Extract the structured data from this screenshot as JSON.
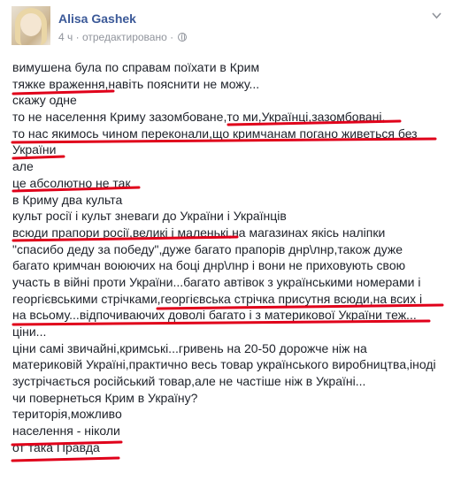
{
  "post": {
    "author": "Alisa Gashek",
    "time": "4 ч",
    "separator": "·",
    "edited": "отредактировано",
    "lines": [
      "вимушена була по справам поїхати в Крим",
      "тяжке враження,навіть пояснити не можу...",
      "скажу одне",
      "то не населення Криму зазомбоване,то ми,Українці,зазомбовані,",
      "то нас якимось чином переконали,що кримчанам погано живеться без",
      "України",
      "але",
      "це абсолютно не так",
      "в Криму два культа",
      "культ росії і культ зневаги до України і Українців",
      "всюди прапори росії,великі і маленькі,на магазинах якісь наліпки",
      "\"спасибо деду за победу\",дуже багато прапорів днр\\лнр,також дуже",
      "багато кримчан воюючих на боці днр\\лнр і вони не приховують свою",
      "участь в війні проти України...багато автівок з українськими номерами і",
      "георгієвськими стрічками,георгієвська стрічка присутня всюди,на всих і",
      "на всьому...відпочиваючих доволі багато і з материкової України теж...",
      "ціни...",
      "ціни самі звичайні,кримські...гривень на 20-50 дорожче ніж на",
      "материковій Україні,практично весь товар українського виробництва,іноді",
      "зустрічається російський товар,але не частіше ніж в Україні...",
      "чи повернеться Крим в Україну?",
      "територія,можливо",
      "населення - ніколи",
      "от така Правда"
    ]
  },
  "icons": {
    "avatar": "profile-photo",
    "privacy": "globe-icon",
    "menu": "chevron-down-icon"
  },
  "colors": {
    "author_link": "#3b5998",
    "meta_text": "#90949c",
    "body_text": "#1d2129",
    "underline": "#e0001a"
  }
}
